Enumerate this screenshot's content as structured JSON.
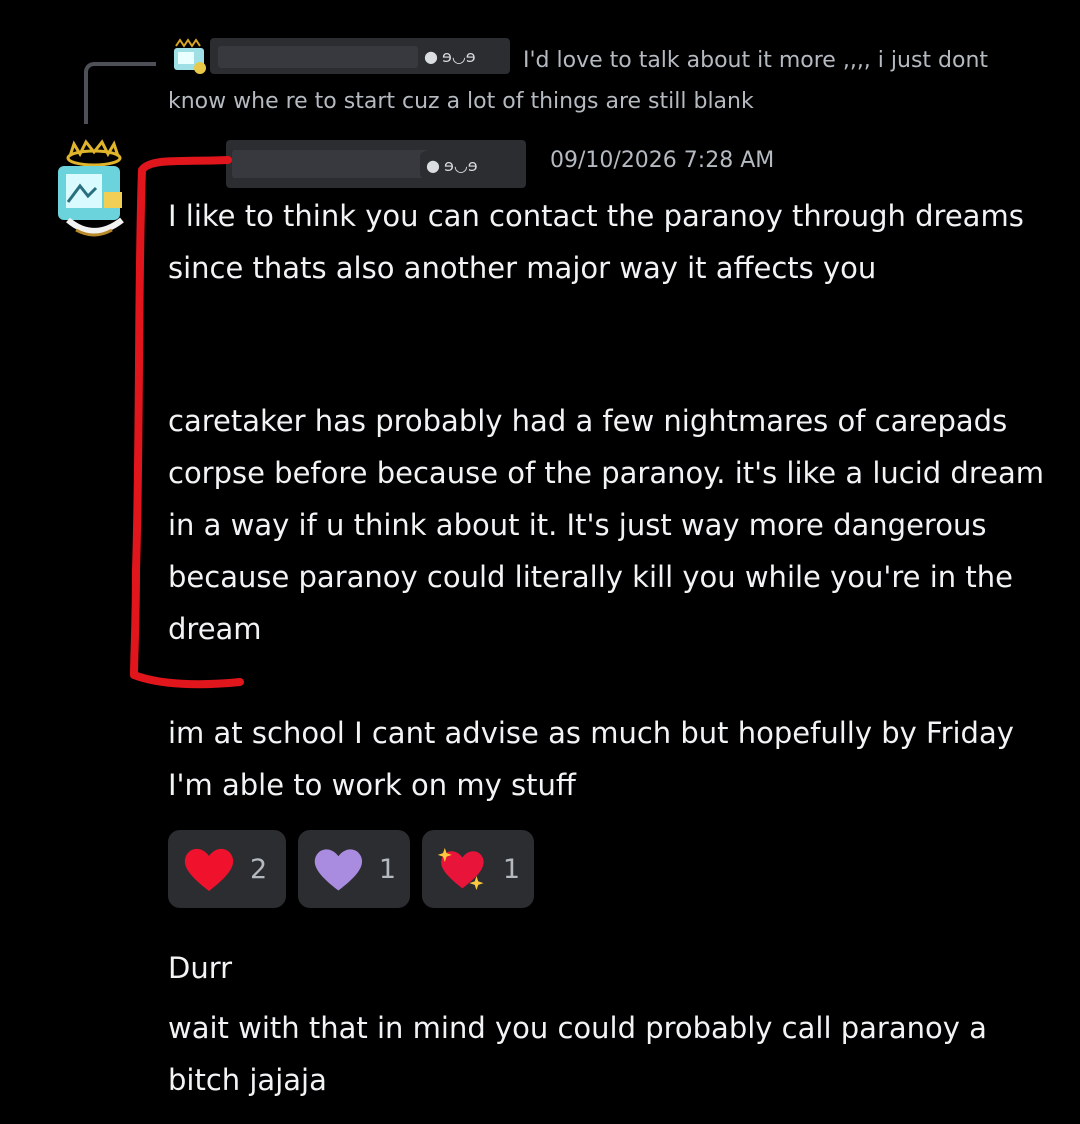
{
  "reply": {
    "tag": "ɘ◡ɘ",
    "text": "I'd love to talk about it more ,,,, i just dont know whe re to start cuz a lot of things are still blank"
  },
  "message": {
    "tag": "ɘ◡ɘ",
    "timestamp": "09/10/2026 7:28 AM",
    "paragraphs": [
      "I like to think you can contact the paranoy through dreams since thats also another major way it affects you",
      "caretaker has probably had a few nightmares of carepads corpse before because of the paranoy. it's like a lucid dream in a way if u think about it. It's just way more dangerous because paranoy could literally kill you while you're in the dream",
      "im at school I cant advise as much but hopefully by Friday I'm able to work on my stuff"
    ],
    "reactions": [
      {
        "icon": "red-heart-icon",
        "count": "2"
      },
      {
        "icon": "purple-heart-icon",
        "count": "1"
      },
      {
        "icon": "sparkling-heart-icon",
        "count": "1"
      }
    ]
  },
  "followups": [
    "Durr",
    "wait with that in mind you could probably call paranoy a bitch jajaja"
  ],
  "colors": {
    "background": "#000000",
    "text": "#f2f3f5",
    "muted": "#b5bac1",
    "pill": "#2b2d31",
    "annotation": "#e0161c"
  }
}
